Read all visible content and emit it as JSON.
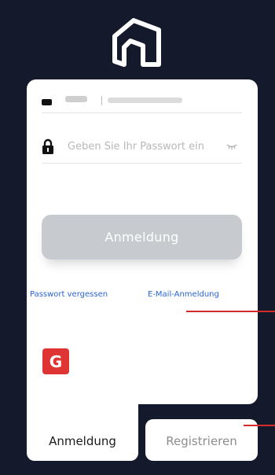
{
  "app": {
    "logo": "house-logo"
  },
  "login": {
    "phone_field": {
      "icon": "phone-icon"
    },
    "password_field": {
      "placeholder": "Geben Sie Ihr Passwort ein",
      "icon": "lock-icon",
      "toggle_icon": "eye-closed-icon"
    },
    "submit_label": "Anmeldung"
  },
  "links": {
    "forgot_password": "Passwort vergessen",
    "email_login": "E-Mail-Anmeldung"
  },
  "social": {
    "google_label": "G"
  },
  "tabs": {
    "login_label": "Anmeldung",
    "register_label": "Registrieren"
  },
  "colors": {
    "background": "#141a2b",
    "card": "#ffffff",
    "button_disabled": "#c7cbcf",
    "link": "#2a64d6",
    "google": "#df3434",
    "annotation": "#d42a2a"
  }
}
